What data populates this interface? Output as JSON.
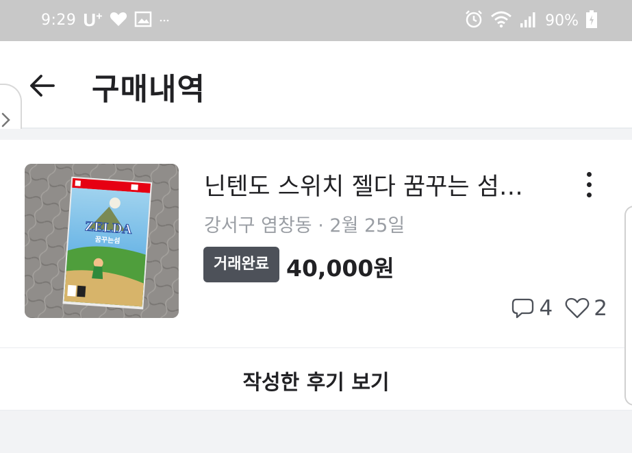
{
  "status_bar": {
    "time": "9:29",
    "carrier": "U",
    "carrier_sup": "+",
    "battery": "90%"
  },
  "header": {
    "title": "구매내역"
  },
  "item": {
    "title": "닌텐도 스위치 젤다 꿈꾸는 섬…",
    "location": "강서구 염창동",
    "separator": "·",
    "date": "2월 25일",
    "status": "거래완료",
    "price": "40,000원",
    "chat_count": "4",
    "like_count": "2",
    "thumb": {
      "logo_text": "ZELDA",
      "subtitle_text": "꿈꾸는섬"
    }
  },
  "review_button": {
    "label": "작성한 후기 보기"
  },
  "colors": {
    "status_bar_bg": "#c8c8c8",
    "badge_bg": "#4d5159",
    "muted_text": "#9a9ea4",
    "divider": "#e9ecef"
  }
}
